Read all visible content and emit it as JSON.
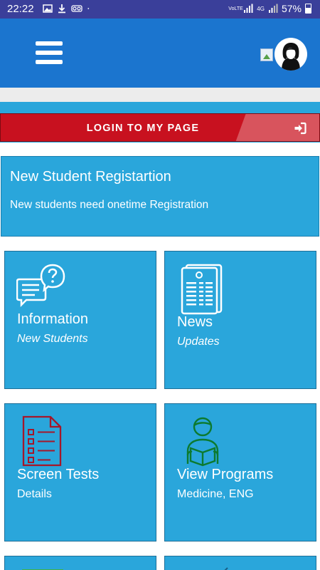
{
  "status_bar": {
    "time": "22:22",
    "network_label": "VoLTE",
    "signal_label": "4G",
    "battery": "57%"
  },
  "app_bar": {
    "menu_icon": "hamburger-menu-icon",
    "avatar_icon": "user-avatar"
  },
  "login": {
    "label": "LOGIN TO MY PAGE",
    "icon": "login-arrow-icon"
  },
  "registration": {
    "title": "New Student Registartion",
    "subtitle": "New students need onetime Registration"
  },
  "tiles": [
    {
      "title": "Information",
      "subtitle": "New Students",
      "icon": "chat-question-icon"
    },
    {
      "title": "News",
      "subtitle": "Updates",
      "icon": "newspaper-icon"
    },
    {
      "title": "Screen Tests",
      "subtitle": "Details",
      "icon": "checklist-icon"
    },
    {
      "title": "View Programs",
      "subtitle": "Medicine, ENG",
      "icon": "student-reading-icon"
    }
  ],
  "colors": {
    "status_bar": "#3a3f9a",
    "app_bar": "#1b75cf",
    "tile": "#2aa6db",
    "login": "#c8111f"
  }
}
